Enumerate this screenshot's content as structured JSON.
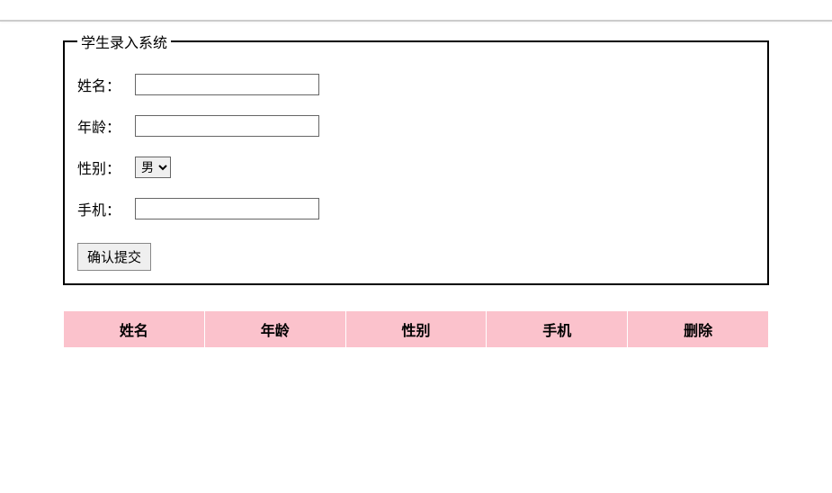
{
  "form": {
    "legend": "学生录入系统",
    "fields": {
      "name_label": "姓名：",
      "name_value": "",
      "age_label": "年龄：",
      "age_value": "",
      "gender_label": "性别：",
      "gender_selected": "男",
      "phone_label": "手机：",
      "phone_value": ""
    },
    "submit_label": "确认提交"
  },
  "table": {
    "headers": {
      "name": "姓名",
      "age": "年龄",
      "gender": "性别",
      "phone": "手机",
      "delete": "删除"
    }
  }
}
